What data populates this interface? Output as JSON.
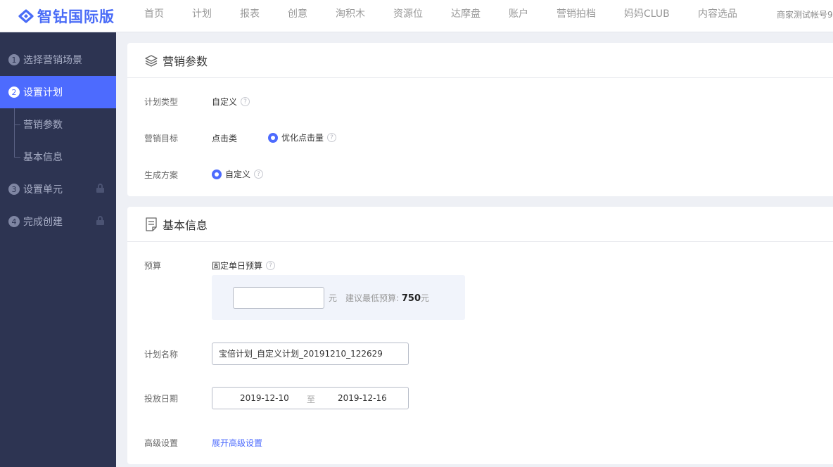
{
  "header": {
    "logo_text": "智钻国际版",
    "nav": [
      "首页",
      "计划",
      "报表",
      "创意",
      "淘积木",
      "资源位",
      "达摩盘",
      "账户",
      "营销拍档",
      "妈妈CLUB",
      "内容选品"
    ],
    "account": "商家测试帐号9",
    "brand_color": "#4a6cf7"
  },
  "sidebar": {
    "steps": [
      {
        "num": "1",
        "label": "选择营销场景"
      },
      {
        "num": "2",
        "label": "设置计划"
      },
      {
        "num": "3",
        "label": "设置单元"
      },
      {
        "num": "4",
        "label": "完成创建"
      }
    ],
    "substeps": [
      "营销参数",
      "基本信息"
    ],
    "active_color": "#4d6bfe",
    "bg_color": "#2d3452"
  },
  "marketing": {
    "title": "营销参数",
    "plan_type_label": "计划类型",
    "plan_type_value": "自定义",
    "goal_label": "营销目标",
    "goal_category": "点击类",
    "goal_value": "优化点击量",
    "scheme_label": "生成方案",
    "scheme_value": "自定义",
    "help_glyph": "?"
  },
  "basic": {
    "title": "基本信息",
    "budget_label": "预算",
    "budget_type": "固定单日预算",
    "budget_value": "",
    "budget_unit": "元",
    "budget_hint_prefix": "建议最低预算:",
    "budget_min": "750",
    "budget_min_unit": "元",
    "plan_name_label": "计划名称",
    "plan_name_value": "宝倍计划_自定义计划_20191210_122629",
    "date_label": "投放日期",
    "date_start": "2019-12-10",
    "date_sep": "至",
    "date_end": "2019-12-16",
    "advanced_label": "高级设置",
    "advanced_link": "展开高级设置"
  }
}
